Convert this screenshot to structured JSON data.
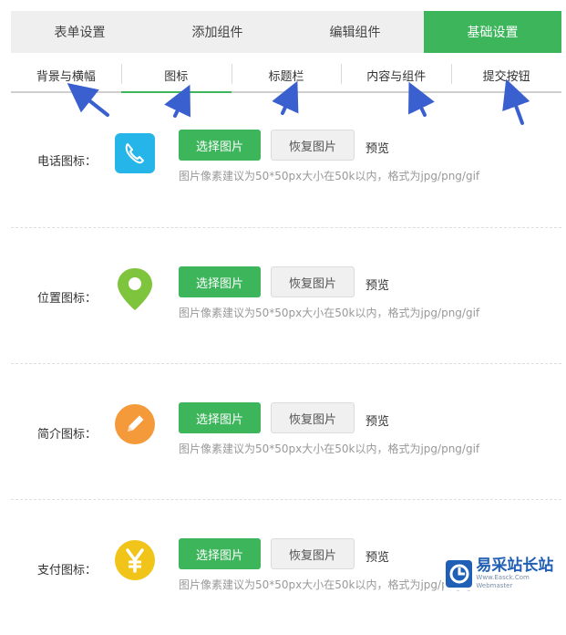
{
  "tabs": [
    {
      "label": "表单设置"
    },
    {
      "label": "添加组件"
    },
    {
      "label": "编辑组件"
    },
    {
      "label": "基础设置"
    }
  ],
  "active_tab": "基础设置",
  "subtabs": [
    {
      "label": "背景与横幅"
    },
    {
      "label": "图标"
    },
    {
      "label": "标题栏"
    },
    {
      "label": "内容与组件"
    },
    {
      "label": "提交按钮"
    }
  ],
  "active_subtab": "图标",
  "rows": [
    {
      "label": "电话图标：",
      "icon": "phone-icon",
      "choose": "选择图片",
      "restore": "恢复图片",
      "preview": "预览",
      "hint": "图片像素建议为50*50px大小在50k以内，格式为jpg/png/gif"
    },
    {
      "label": "位置图标：",
      "icon": "location-pin-icon",
      "choose": "选择图片",
      "restore": "恢复图片",
      "preview": "预览",
      "hint": "图片像素建议为50*50px大小在50k以内，格式为jpg/png/gif"
    },
    {
      "label": "简介图标：",
      "icon": "pencil-icon",
      "choose": "选择图片",
      "restore": "恢复图片",
      "preview": "预览",
      "hint": "图片像素建议为50*50px大小在50k以内，格式为jpg/png/gif"
    },
    {
      "label": "支付图标：",
      "icon": "yen-icon",
      "choose": "选择图片",
      "restore": "恢复图片",
      "preview": "预览",
      "hint": "图片像素建议为50*50px大小在50k以内，格式为jpg/png/gif"
    }
  ],
  "watermark": {
    "title": "易采站长站",
    "subtitle": "Www.Easck.Com  Webmaster"
  },
  "colors": {
    "accent": "#3cb55b",
    "phone_icon_bg": "#25b5e8",
    "location_icon": "#7ec43c",
    "pencil_icon_bg": "#f59a3b",
    "yen_icon_bg": "#f0c419",
    "arrow": "#3a5fcf"
  }
}
